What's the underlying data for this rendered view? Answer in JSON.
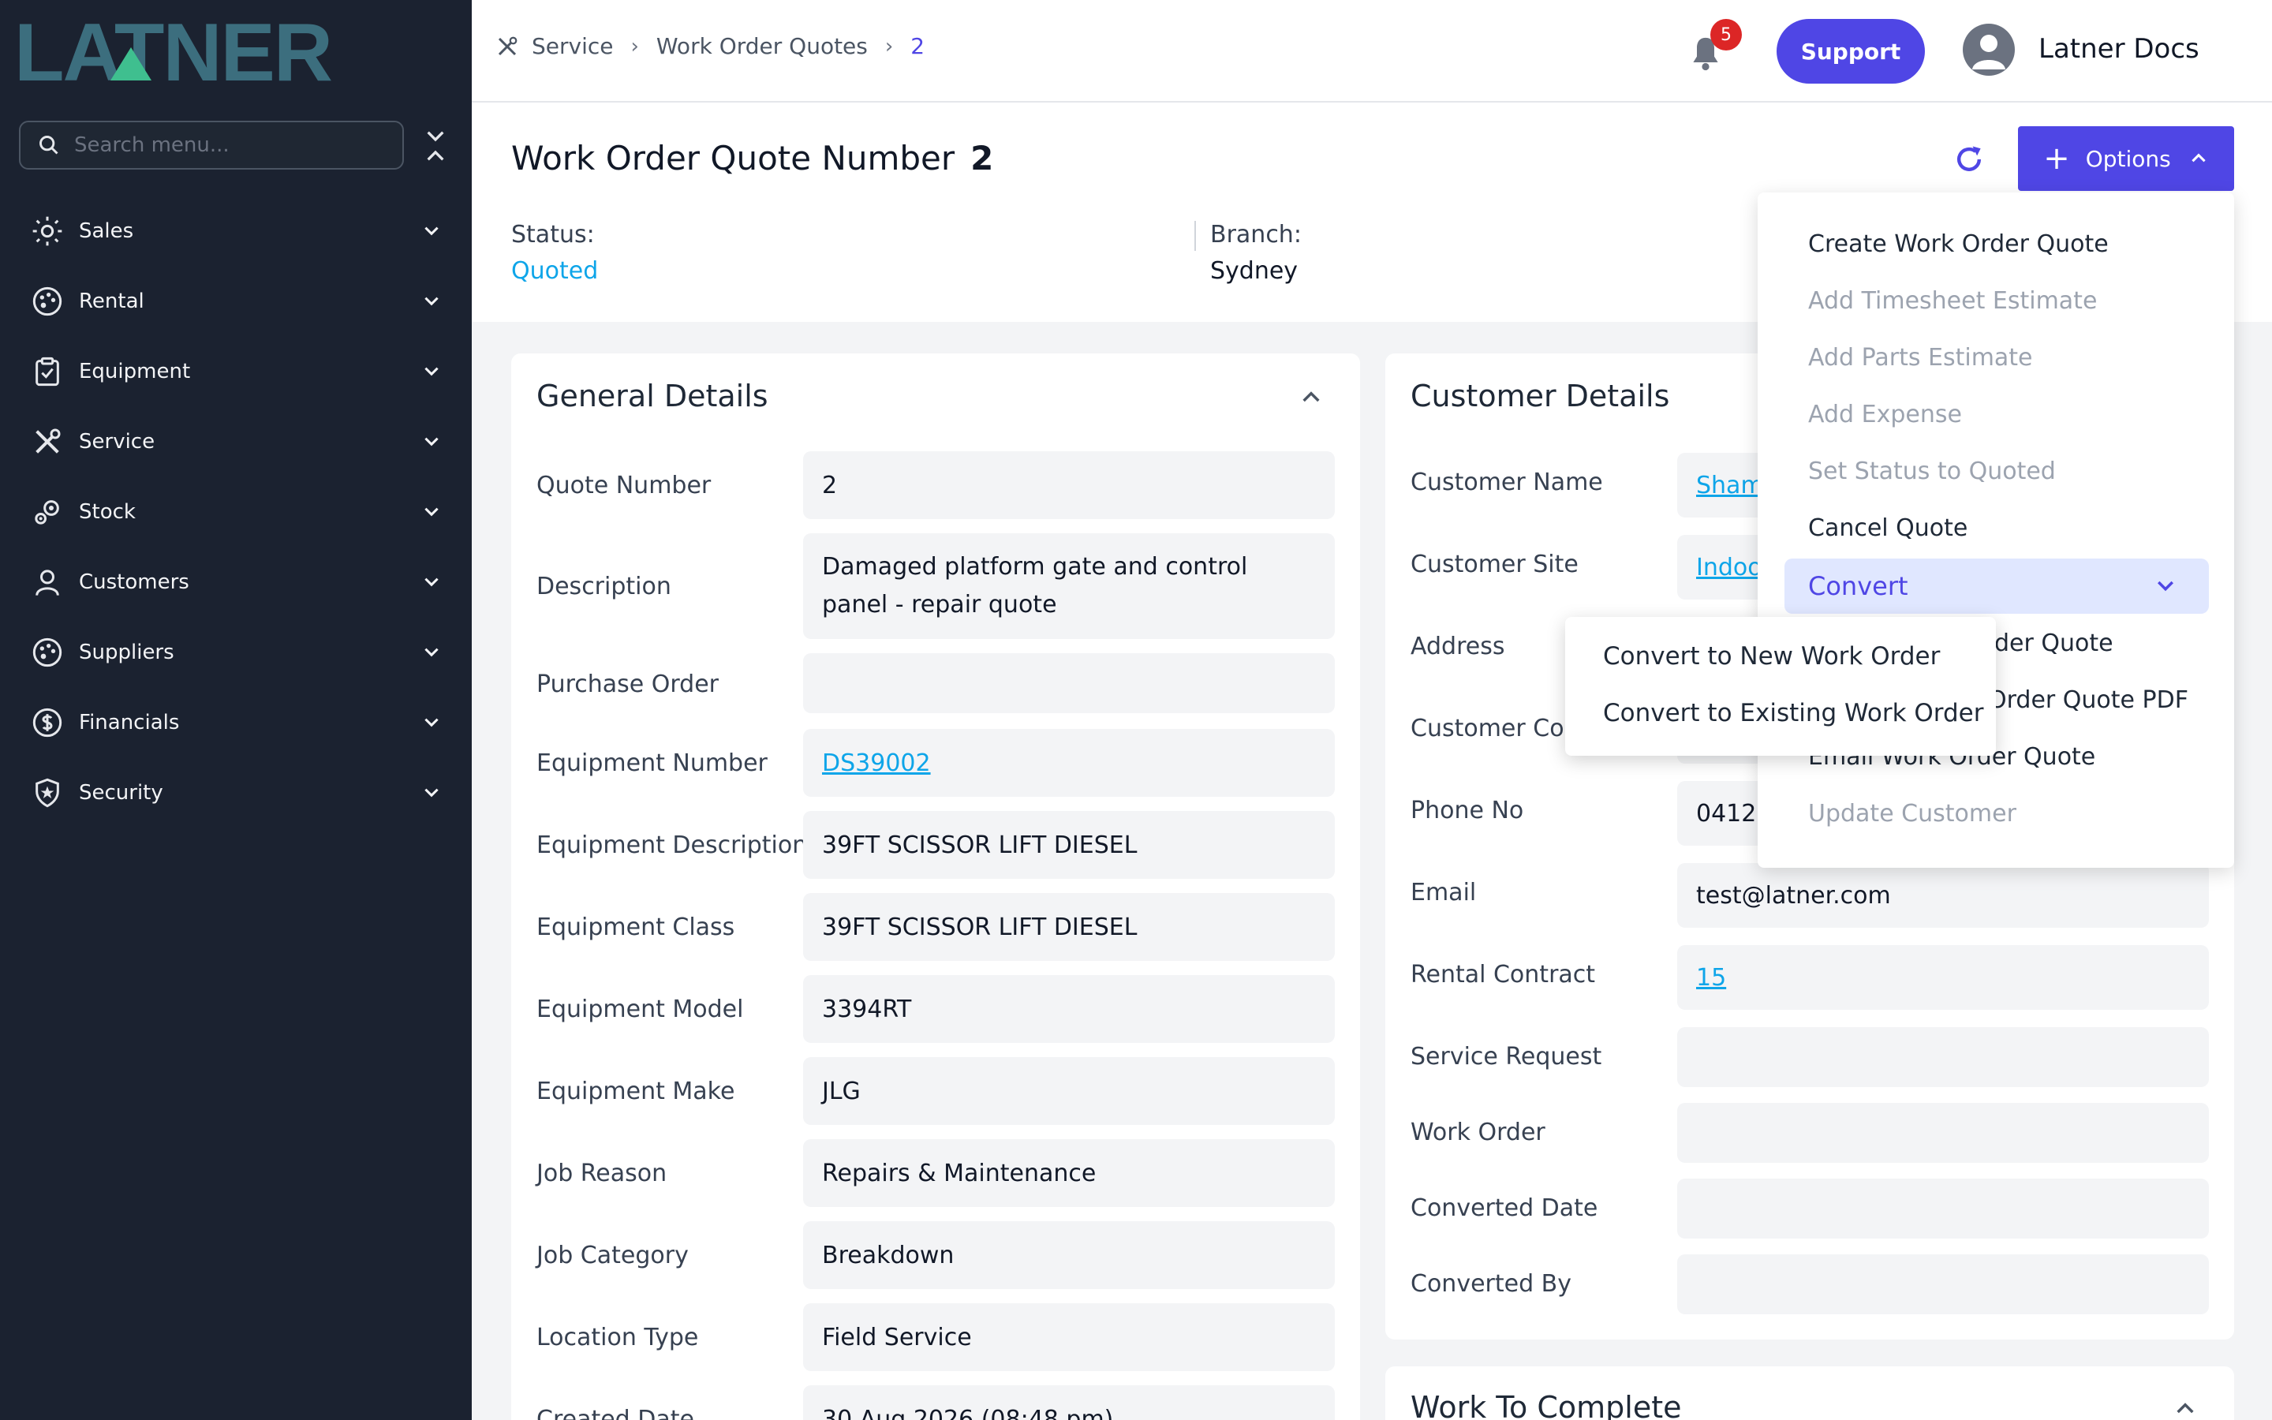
{
  "brand": {
    "name": "LATNER"
  },
  "sidebar": {
    "search_placeholder": "Search menu...",
    "items": [
      {
        "label": "Sales",
        "icon": "sun-icon"
      },
      {
        "label": "Rental",
        "icon": "palette-icon"
      },
      {
        "label": "Equipment",
        "icon": "clipboard-icon"
      },
      {
        "label": "Service",
        "icon": "tools-icon"
      },
      {
        "label": "Stock",
        "icon": "gears-icon"
      },
      {
        "label": "Customers",
        "icon": "user-icon"
      },
      {
        "label": "Suppliers",
        "icon": "palette-icon"
      },
      {
        "label": "Financials",
        "icon": "dollar-icon"
      },
      {
        "label": "Security",
        "icon": "shield-icon"
      }
    ]
  },
  "topbar": {
    "breadcrumb": [
      "Service",
      "Work Order Quotes",
      "2"
    ],
    "notifications": "5",
    "support_label": "Support",
    "username": "Latner Docs"
  },
  "header": {
    "title": "Work Order Quote Number",
    "number": "2",
    "options_label": "Options",
    "status_label": "Status:",
    "status_value": "Quoted",
    "branch_label": "Branch:",
    "branch_value": "Sydney"
  },
  "general": {
    "title": "General Details",
    "rows": [
      {
        "label": "Quote Number",
        "value": "2"
      },
      {
        "label": "Description",
        "value": "Damaged platform gate and control panel - repair quote"
      },
      {
        "label": "Purchase Order",
        "value": ""
      },
      {
        "label": "Equipment Number",
        "value": "DS39002"
      },
      {
        "label": "Equipment Description",
        "value": "39FT SCISSOR LIFT DIESEL"
      },
      {
        "label": "Equipment Class",
        "value": "39FT SCISSOR LIFT DIESEL"
      },
      {
        "label": "Equipment Model",
        "value": "3394RT"
      },
      {
        "label": "Equipment Make",
        "value": "JLG"
      },
      {
        "label": "Job Reason",
        "value": "Repairs & Maintenance"
      },
      {
        "label": "Job Category",
        "value": "Breakdown"
      },
      {
        "label": "Location Type",
        "value": "Field Service"
      },
      {
        "label": "Created Date",
        "value": "30 Aug 2026 (08:48 pm)"
      }
    ]
  },
  "customer": {
    "title": "Customer Details",
    "rows": [
      {
        "label": "Customer Name",
        "value": "Sham"
      },
      {
        "label": "Customer Site",
        "value": "Indoo"
      },
      {
        "label": "Address",
        "value": ""
      },
      {
        "label": "Customer Co",
        "value": ""
      },
      {
        "label": "Phone No",
        "value": "0412"
      },
      {
        "label": "Email",
        "value": "test@latner.com"
      },
      {
        "label": "Rental Contract",
        "value": "15"
      },
      {
        "label": "Service Request",
        "value": ""
      },
      {
        "label": "Work Order",
        "value": ""
      },
      {
        "label": "Converted Date",
        "value": ""
      },
      {
        "label": "Converted By",
        "value": ""
      }
    ]
  },
  "work_to_complete": {
    "title": "Work To Complete"
  },
  "options_menu": {
    "items": [
      {
        "label": "Create Work Order Quote",
        "disabled": false
      },
      {
        "label": "Add Timesheet Estimate",
        "disabled": true
      },
      {
        "label": "Add Parts Estimate",
        "disabled": true
      },
      {
        "label": "Add Expense",
        "disabled": true
      },
      {
        "label": "Set Status to Quoted",
        "disabled": true
      },
      {
        "label": "Cancel Quote",
        "disabled": false
      },
      {
        "label": "Convert",
        "disabled": false
      },
      {
        "label": "der Quote",
        "disabled": false
      },
      {
        "label": "Order Quote PDF",
        "disabled": false
      },
      {
        "label": "Email Work Order Quote",
        "disabled": false
      },
      {
        "label": "Update Customer",
        "disabled": true
      }
    ],
    "submenu": [
      "Convert to New Work Order",
      "Convert to Existing Work Order"
    ]
  },
  "colors": {
    "sidebar": "#1b2230",
    "accent": "#4f46e5",
    "link": "#0ea5e9",
    "logo": "#3c6e7e",
    "logo_triangle": "#3fbf8f"
  }
}
